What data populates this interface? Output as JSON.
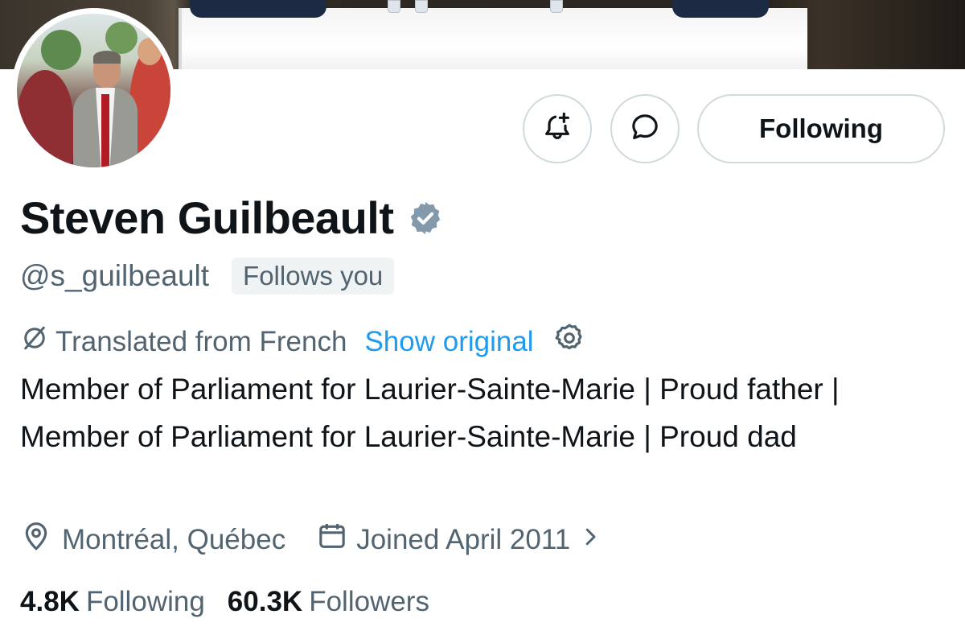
{
  "profile": {
    "name": "Steven Guilbeault",
    "handle": "@s_guilbeault",
    "follows_you": "Follows you",
    "verified_icon": "verified-badge-icon"
  },
  "actions": {
    "notify_icon": "bell-plus-icon",
    "message_icon": "message-bubble-icon",
    "following_label": "Following"
  },
  "translation": {
    "label": "Translated from French",
    "show_original": "Show original"
  },
  "bio": "Member of Parliament for Laurier-Sainte-Marie | Proud father | Member of Parliament for Laurier-Sainte-Marie | Proud dad",
  "meta": {
    "location": "Montréal, Québec",
    "joined": "Joined April 2011"
  },
  "stats": {
    "following_count": "4.8K",
    "following_label": "Following",
    "followers_count": "60.3K",
    "followers_label": "Followers"
  },
  "colors": {
    "text": "#0f1419",
    "muted": "#536471",
    "link": "#1d9bf0",
    "border": "#cfd9de",
    "badge_bg": "#eff3f4",
    "verified": "#829aab"
  }
}
